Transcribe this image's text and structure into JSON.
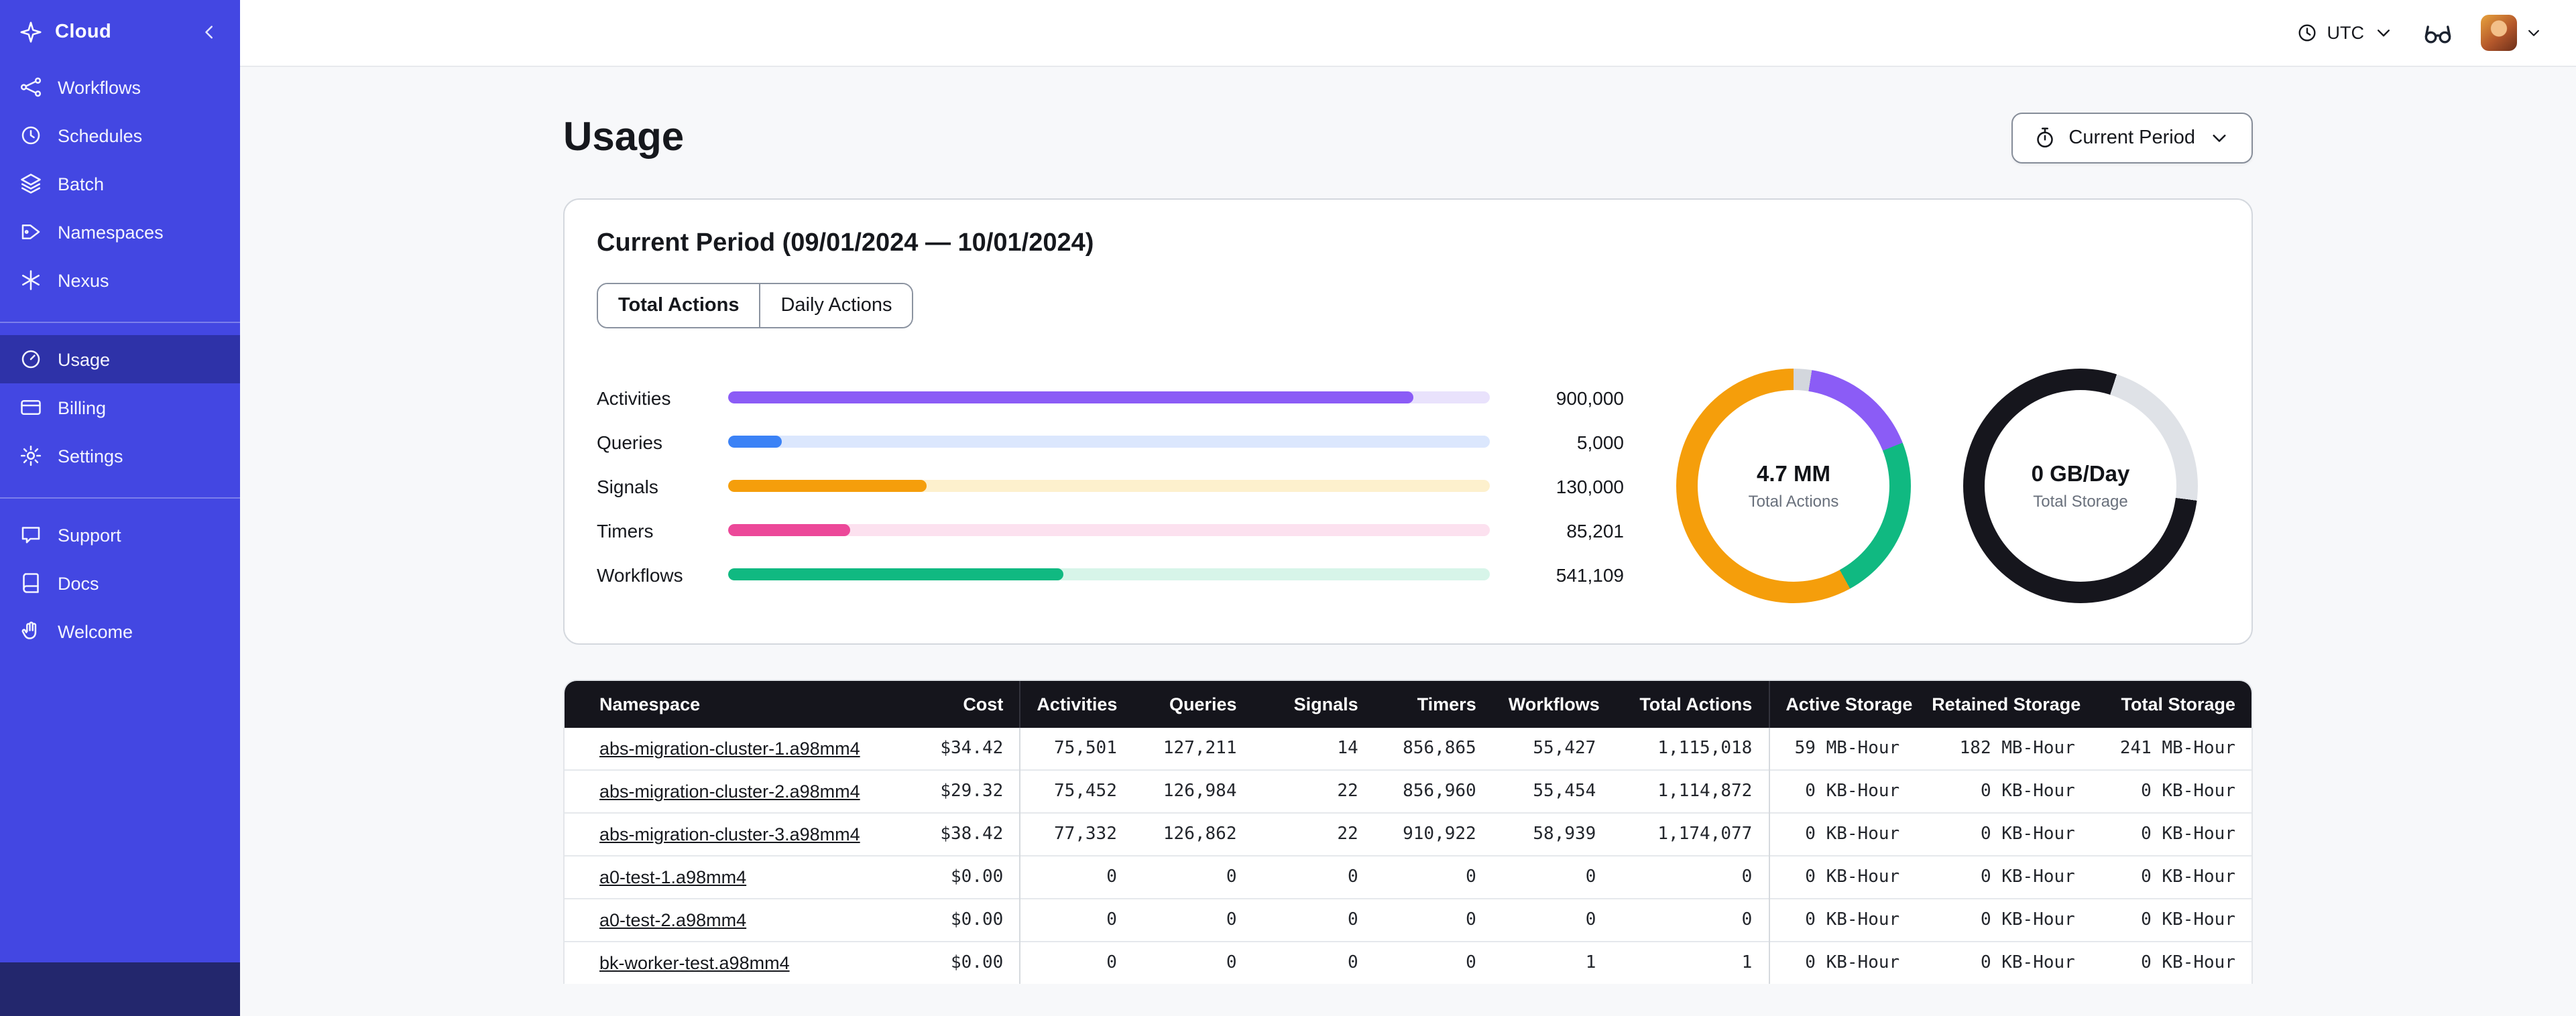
{
  "brand_color": "#4347e2",
  "sidebar": {
    "brand": "Cloud",
    "groups": [
      {
        "items": [
          {
            "label": "Workflows",
            "icon": "workflows-icon"
          },
          {
            "label": "Schedules",
            "icon": "schedules-icon"
          },
          {
            "label": "Batch",
            "icon": "batch-icon"
          },
          {
            "label": "Namespaces",
            "icon": "namespaces-icon"
          },
          {
            "label": "Nexus",
            "icon": "nexus-icon"
          }
        ]
      },
      {
        "items": [
          {
            "label": "Usage",
            "icon": "usage-icon",
            "active": true
          },
          {
            "label": "Billing",
            "icon": "billing-icon"
          },
          {
            "label": "Settings",
            "icon": "settings-icon"
          }
        ]
      },
      {
        "items": [
          {
            "label": "Support",
            "icon": "support-icon"
          },
          {
            "label": "Docs",
            "icon": "docs-icon"
          },
          {
            "label": "Welcome",
            "icon": "welcome-icon"
          }
        ]
      }
    ]
  },
  "topbar": {
    "timezone": "UTC"
  },
  "page": {
    "title": "Usage",
    "period_button": "Current Period"
  },
  "usage_card": {
    "title": "Current Period (09/01/2024 — 10/01/2024)",
    "tabs": [
      {
        "label": "Total Actions",
        "active": true
      },
      {
        "label": "Daily Actions",
        "active": false
      }
    ],
    "bars": [
      {
        "label": "Activities",
        "value": 900000,
        "value_display": "900,000",
        "bar_percent": 90,
        "color": "#8b5cf6",
        "track_color": "#e9e2fc"
      },
      {
        "label": "Queries",
        "value": 5000,
        "value_display": "5,000",
        "bar_percent": 7,
        "color": "#3b82f6",
        "track_color": "#dbe7fd"
      },
      {
        "label": "Signals",
        "value": 130000,
        "value_display": "130,000",
        "bar_percent": 26,
        "color": "#f59e0b",
        "track_color": "#fdf0cd"
      },
      {
        "label": "Timers",
        "value": 85201,
        "value_display": "85,201",
        "bar_percent": 16,
        "color": "#ec4899",
        "track_color": "#fce1ef"
      },
      {
        "label": "Workflows",
        "value": 541109,
        "value_display": "541,109",
        "bar_percent": 44,
        "color": "#10b981",
        "track_color": "#d7f5e9"
      }
    ],
    "donuts": [
      {
        "value": "4.7 MM",
        "label": "Total Actions",
        "segments": [
          {
            "color": "#d3d7dd",
            "from": 0,
            "to": 2.5
          },
          {
            "color": "#8b5cf6",
            "from": 2.5,
            "to": 19
          },
          {
            "color": "#10b981",
            "from": 19,
            "to": 42
          },
          {
            "color": "#f59e0b",
            "from": 42,
            "to": 100
          }
        ]
      },
      {
        "value": "0 GB/Day",
        "label": "Total Storage",
        "segments": [
          {
            "color": "#16161d",
            "from": 0,
            "to": 5
          },
          {
            "color": "#dfe2e7",
            "from": 5,
            "to": 27
          },
          {
            "color": "#16161d",
            "from": 27,
            "to": 100
          }
        ]
      }
    ]
  },
  "table": {
    "columns": [
      {
        "label": "Namespace"
      },
      {
        "label": "Cost"
      },
      {
        "label": "Activities"
      },
      {
        "label": "Queries"
      },
      {
        "label": "Signals"
      },
      {
        "label": "Timers"
      },
      {
        "label": "Workflows"
      },
      {
        "label": "Total Actions"
      },
      {
        "label": "Active Storage"
      },
      {
        "label": "Retained Storage"
      },
      {
        "label": "Total Storage"
      }
    ],
    "divider_after": [
      1,
      7
    ],
    "col_widths": [
      19.5,
      7.5,
      6.7,
      7.1,
      7.2,
      7.0,
      7.1,
      9.3,
      8.7,
      10.4,
      9.5
    ],
    "rows": [
      {
        "cells": [
          "abs-migration-cluster-1.a98mm4",
          "$34.42",
          "75,501",
          "127,211",
          "14",
          "856,865",
          "55,427",
          "1,115,018",
          "59 MB-Hour",
          "182 MB-Hour",
          "241 MB-Hour"
        ]
      },
      {
        "cells": [
          "abs-migration-cluster-2.a98mm4",
          "$29.32",
          "75,452",
          "126,984",
          "22",
          "856,960",
          "55,454",
          "1,114,872",
          "0 KB-Hour",
          "0 KB-Hour",
          "0 KB-Hour"
        ]
      },
      {
        "cells": [
          "abs-migration-cluster-3.a98mm4",
          "$38.42",
          "77,332",
          "126,862",
          "22",
          "910,922",
          "58,939",
          "1,174,077",
          "0 KB-Hour",
          "0 KB-Hour",
          "0 KB-Hour"
        ]
      },
      {
        "cells": [
          "a0-test-1.a98mm4",
          "$0.00",
          "0",
          "0",
          "0",
          "0",
          "0",
          "0",
          "0 KB-Hour",
          "0 KB-Hour",
          "0 KB-Hour"
        ]
      },
      {
        "cells": [
          "a0-test-2.a98mm4",
          "$0.00",
          "0",
          "0",
          "0",
          "0",
          "0",
          "0",
          "0 KB-Hour",
          "0 KB-Hour",
          "0 KB-Hour"
        ]
      },
      {
        "cells": [
          "bk-worker-test.a98mm4",
          "$0.00",
          "0",
          "0",
          "0",
          "0",
          "1",
          "1",
          "0 KB-Hour",
          "0 KB-Hour",
          "0 KB-Hour"
        ]
      }
    ]
  }
}
